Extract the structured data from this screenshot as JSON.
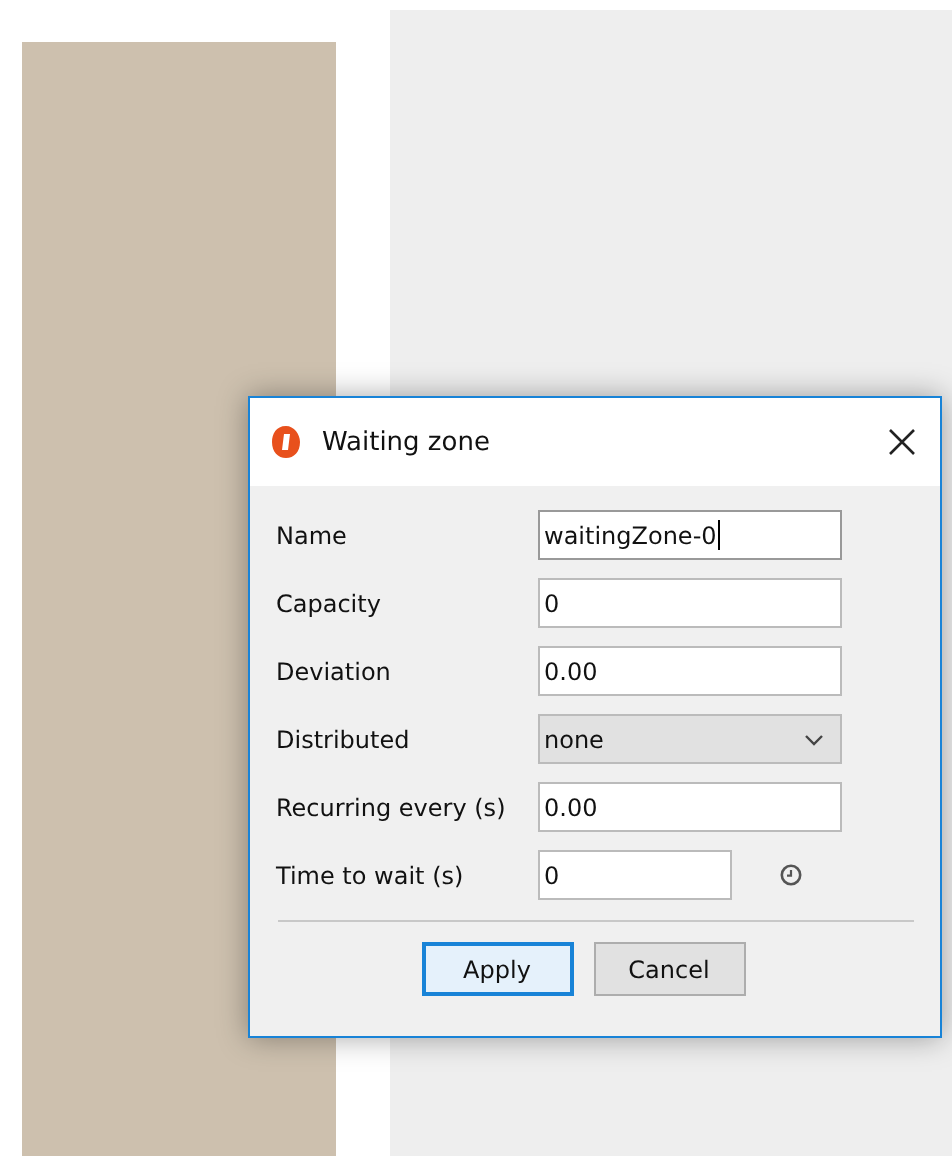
{
  "dialog": {
    "title": "Waiting zone",
    "fields": [
      {
        "kind": "text",
        "label": "Name",
        "value": "waitingZone-0",
        "focused": true
      },
      {
        "kind": "text",
        "label": "Capacity",
        "value": "0",
        "focused": false
      },
      {
        "kind": "text",
        "label": "Deviation",
        "value": "0.00",
        "focused": false
      },
      {
        "kind": "select",
        "label": "Distributed",
        "value": "none"
      },
      {
        "kind": "text",
        "label": "Recurring every (s)",
        "value": "0.00",
        "focused": false
      },
      {
        "kind": "time",
        "label": "Time to wait (s)",
        "value": "0",
        "focused": false
      }
    ],
    "buttons": [
      {
        "label": "Apply",
        "default": true
      },
      {
        "label": "Cancel",
        "default": false
      }
    ]
  }
}
